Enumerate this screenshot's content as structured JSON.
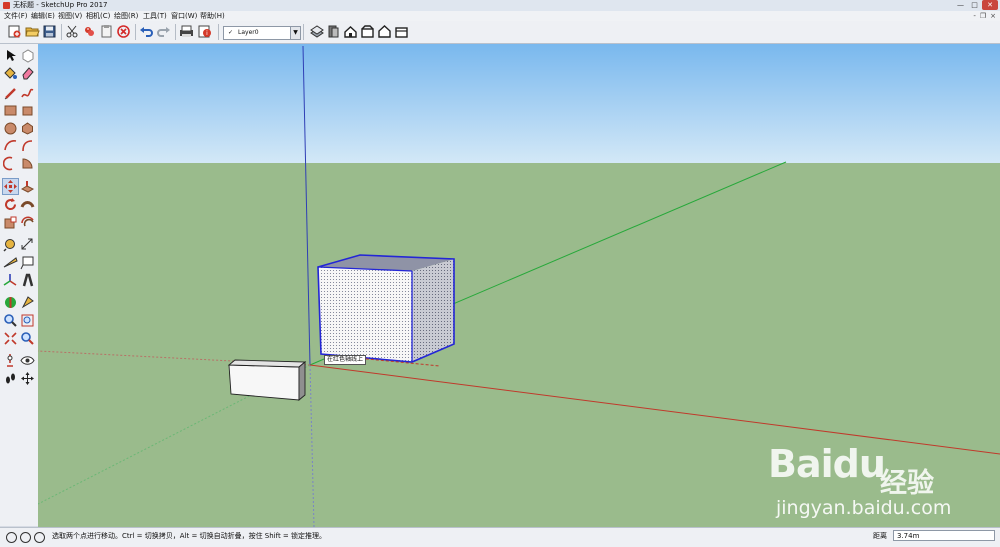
{
  "window": {
    "title": "无标题 - SketchUp Pro 2017",
    "controls": [
      "—",
      "□",
      "✕"
    ]
  },
  "menu": {
    "items": [
      "文件(F)",
      "编辑(E)",
      "视图(V)",
      "相机(C)",
      "绘图(R)",
      "工具(T)",
      "窗口(W)",
      "帮助(H)"
    ],
    "mdi_controls": [
      "-",
      "❐",
      "×"
    ]
  },
  "toolbar": {
    "layer": {
      "current": "Layer0",
      "check": "✓",
      "arrow": "▼"
    }
  },
  "viewport": {
    "inference_tooltip": "在红色轴线上"
  },
  "watermark": {
    "logo": "Baidu",
    "cn": "经验",
    "url": "jingyan.baidu.com"
  },
  "status": {
    "message": "选取两个点进行移动。Ctrl = 切换拷贝，Alt = 切换自动折叠，按住 Shift = 锁定推理。",
    "measure_label": "距离",
    "measure_value": "3.74m"
  },
  "colors": {
    "sky_top": "#79b8ee",
    "sky_bottom": "#d3e8f7",
    "ground": "#9abb8c",
    "axis_red": "#c0392b",
    "axis_green": "#27a83a",
    "axis_blue": "#2f3fb5",
    "selection_blue": "#2326d6"
  }
}
